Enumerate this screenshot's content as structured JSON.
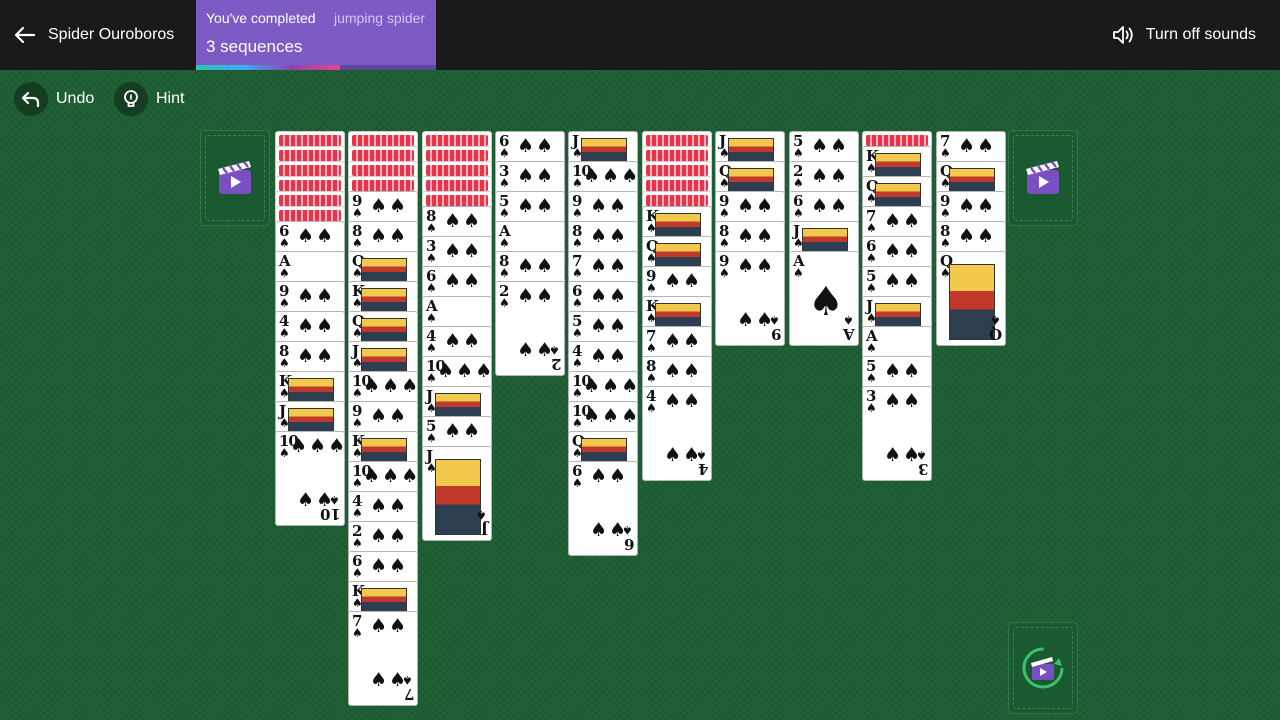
{
  "header": {
    "back_label": "Spider Ouroboros",
    "sound_label": "Turn off sounds"
  },
  "progress": {
    "line1": "You've completed",
    "line1_secondary": "jumping spider",
    "line2": "3 sequences",
    "fraction": 0.6
  },
  "toolbar": {
    "undo_label": "Undo",
    "hint_label": "Hint"
  },
  "colors": {
    "felt": "#1d5e33",
    "topbar": "#1a1a1a",
    "progress_panel": "#7c5cc4",
    "card_back_accent": "#e8334a",
    "suit_black": "#111111"
  },
  "icons": {
    "back": "arrow-left-icon",
    "sound": "speaker-icon",
    "undo": "undo-arrow-icon",
    "hint": "lightbulb-icon",
    "video": "video-clapperboard-icon",
    "redeal": "recycle-video-icon"
  },
  "tableau": [
    {
      "face_down": 6,
      "face_up": [
        "6♠",
        "A♠",
        "9♠",
        "4♠",
        "8♠",
        "K♠",
        "J♠",
        "10♠"
      ]
    },
    {
      "face_down": 4,
      "face_up": [
        "9♠",
        "8♠",
        "Q♠",
        "K♠",
        "Q♠",
        "J♠",
        "10♠",
        "9♠",
        "K♠",
        "10♠",
        "4♠",
        "2♠",
        "6♠",
        "K♠",
        "7♠"
      ]
    },
    {
      "face_down": 5,
      "face_up": [
        "8♠",
        "3♠",
        "6♠",
        "A♠",
        "4♠",
        "10♠",
        "J♠",
        "5♠",
        "J♠"
      ]
    },
    {
      "face_down": 0,
      "face_up": [
        "6♠",
        "3♠",
        "5♠",
        "A♠",
        "8♠",
        "2♠"
      ]
    },
    {
      "face_down": 0,
      "face_up": [
        "J♠",
        "10♠",
        "9♠",
        "8♠",
        "7♠",
        "6♠",
        "5♠",
        "4♠",
        "10♠",
        "10♠",
        "Q♠",
        "6♠"
      ]
    },
    {
      "face_down": 5,
      "face_up": [
        "K♠",
        "Q♠",
        "9♠",
        "K♠",
        "7♠",
        "8♠",
        "4♠"
      ]
    },
    {
      "face_down": 0,
      "face_up": [
        "J♠",
        "Q♠",
        "9♠",
        "8♠",
        "9♠"
      ]
    },
    {
      "face_down": 0,
      "face_up": [
        "5♠",
        "2♠",
        "6♠",
        "J♠",
        "A♠"
      ]
    },
    {
      "face_down": 1,
      "face_up": [
        "K♠",
        "Q♠",
        "7♠",
        "6♠",
        "5♠",
        "J♠",
        "A♠",
        "5♠",
        "3♠"
      ]
    },
    {
      "face_down": 0,
      "face_up": [
        "7♠",
        "Q♠",
        "9♠",
        "8♠",
        "Q♠"
      ]
    }
  ]
}
